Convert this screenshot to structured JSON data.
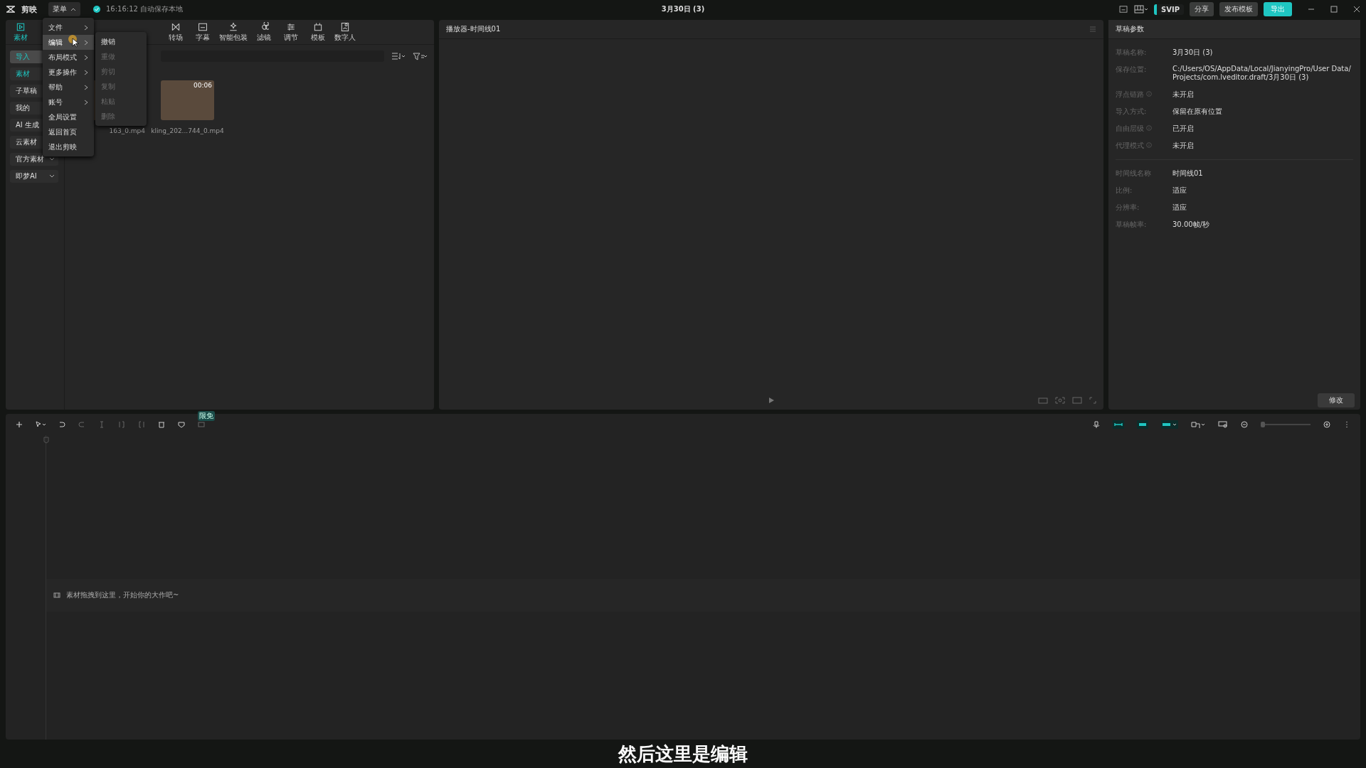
{
  "app": {
    "logo": "剪映",
    "menu_button": "菜单",
    "autosave": "16:16:12 自动保存本地"
  },
  "window": {
    "title": "3月30日 (3)"
  },
  "top_actions": {
    "svip": "SVIP",
    "share": "分享",
    "publish": "发布模板",
    "export": "导出"
  },
  "toolbar_tabs": [
    {
      "label": "素材",
      "kind": "media",
      "selected": true
    },
    {
      "label": "转场",
      "kind": "transition",
      "selected": false
    },
    {
      "label": "字幕",
      "kind": "caption",
      "selected": false
    },
    {
      "label": "智能包装",
      "kind": "magic",
      "selected": false
    },
    {
      "label": "滤镜",
      "kind": "filter",
      "selected": false
    },
    {
      "label": "调节",
      "kind": "adjust",
      "selected": false
    },
    {
      "label": "模板",
      "kind": "template",
      "selected": false
    },
    {
      "label": "数字人",
      "kind": "avatar",
      "selected": false
    }
  ],
  "main_menu": {
    "items": [
      {
        "label": "文件",
        "submenu": true,
        "selected": false
      },
      {
        "label": "编辑",
        "submenu": true,
        "selected": true
      },
      {
        "label": "布局模式",
        "submenu": true,
        "selected": false
      },
      {
        "label": "更多操作",
        "submenu": true,
        "selected": false
      },
      {
        "label": "帮助",
        "submenu": true,
        "selected": false
      },
      {
        "label": "账号",
        "submenu": true,
        "selected": false
      },
      {
        "label": "全局设置",
        "submenu": false,
        "selected": false
      },
      {
        "label": "返回首页",
        "submenu": false,
        "selected": false
      },
      {
        "label": "退出剪映",
        "submenu": false,
        "selected": false
      }
    ],
    "submenu": [
      {
        "label": "撤销",
        "disabled": false
      },
      {
        "label": "重做",
        "disabled": true
      },
      {
        "label": "剪切",
        "disabled": true
      },
      {
        "label": "复制",
        "disabled": true
      },
      {
        "label": "粘贴",
        "disabled": true
      },
      {
        "label": "删除",
        "disabled": true
      }
    ]
  },
  "sidebar": {
    "items": [
      {
        "label": "导入",
        "selected": true,
        "highlighted": true,
        "dropdown": false
      },
      {
        "label": "素材",
        "selected": false,
        "highlighted": true,
        "dropdown": false
      },
      {
        "label": "子草稿",
        "selected": false,
        "highlighted": false,
        "dropdown": false
      },
      {
        "label": "我的",
        "selected": false,
        "highlighted": false,
        "dropdown": false
      },
      {
        "label": "AI 生成",
        "selected": false,
        "highlighted": false,
        "dropdown": false
      },
      {
        "label": "云素材",
        "selected": false,
        "highlighted": false,
        "dropdown": false
      },
      {
        "label": "官方素材",
        "selected": false,
        "highlighted": false,
        "dropdown": true
      },
      {
        "label": "即梦AI",
        "selected": false,
        "highlighted": false,
        "dropdown": true
      }
    ]
  },
  "media": [
    {
      "name": "163_0.mp4"
    },
    {
      "name": "kling_202...744_0.mp4",
      "duration": "00:06"
    }
  ],
  "player": {
    "title": "播放器-时间线01"
  },
  "properties": {
    "title": "草稿参数",
    "groups": [
      [
        {
          "label": "草稿名称:",
          "value": "3月30日 (3)",
          "info": false
        },
        {
          "label": "保存位置:",
          "value": "C:/Users/OS/AppData/Local/JianyingPro/User Data/Projects/com.lveditor.draft/3月30日 (3)",
          "info": false
        },
        {
          "label": "浮点链路",
          "value": "未开启",
          "info": true
        },
        {
          "label": "导入方式:",
          "value": "保留在原有位置",
          "info": false
        },
        {
          "label": "自由层级",
          "value": "已开启",
          "info": true
        },
        {
          "label": "代理模式",
          "value": "未开启",
          "info": true
        }
      ],
      [
        {
          "label": "时间线名称",
          "value": "时间线01",
          "info": false
        },
        {
          "label": "比例:",
          "value": "适应",
          "info": false
        },
        {
          "label": "分辨率:",
          "value": "适应",
          "info": false
        },
        {
          "label": "草稿帧率:",
          "value": "30.00帧/秒",
          "info": false
        }
      ]
    ],
    "button": "修改"
  },
  "zoom_slider": {
    "level": 0
  },
  "timeline": {
    "badge": "限免",
    "hint": "素材拖拽到这里，开始你的大作吧~"
  },
  "caption": "然后这里是编辑"
}
